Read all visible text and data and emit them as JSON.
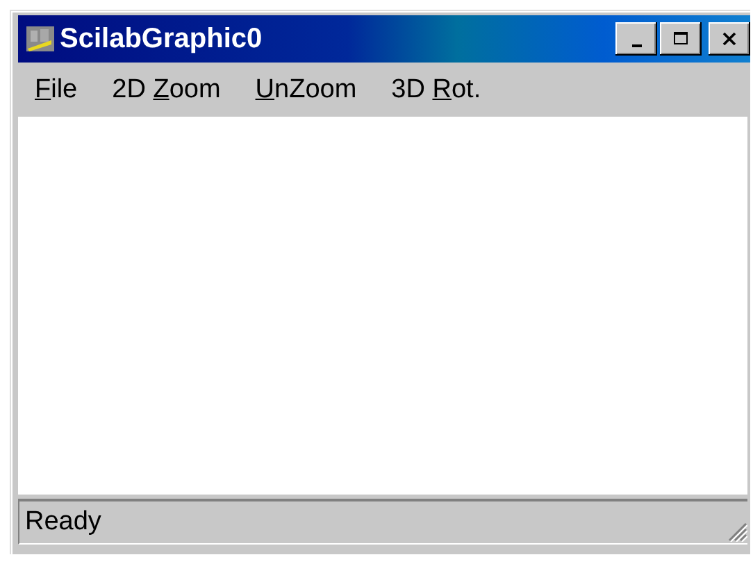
{
  "window": {
    "title": "ScilabGraphic0"
  },
  "title_buttons": [
    {
      "kind": "minimize"
    },
    {
      "kind": "maximize"
    },
    {
      "kind": "close"
    }
  ],
  "menu": [
    {
      "parts": [
        {
          "text": "F",
          "underline": true
        },
        {
          "text": "ile",
          "underline": false
        }
      ]
    },
    {
      "parts": [
        {
          "text": "2D ",
          "underline": false
        },
        {
          "text": "Z",
          "underline": true
        },
        {
          "text": "oom",
          "underline": false
        }
      ]
    },
    {
      "parts": [
        {
          "text": "U",
          "underline": true
        },
        {
          "text": "nZoom",
          "underline": false
        }
      ]
    },
    {
      "parts": [
        {
          "text": "3D ",
          "underline": false
        },
        {
          "text": "R",
          "underline": true
        },
        {
          "text": "ot.",
          "underline": false
        }
      ]
    }
  ],
  "status_bar": {
    "text": "Ready"
  }
}
